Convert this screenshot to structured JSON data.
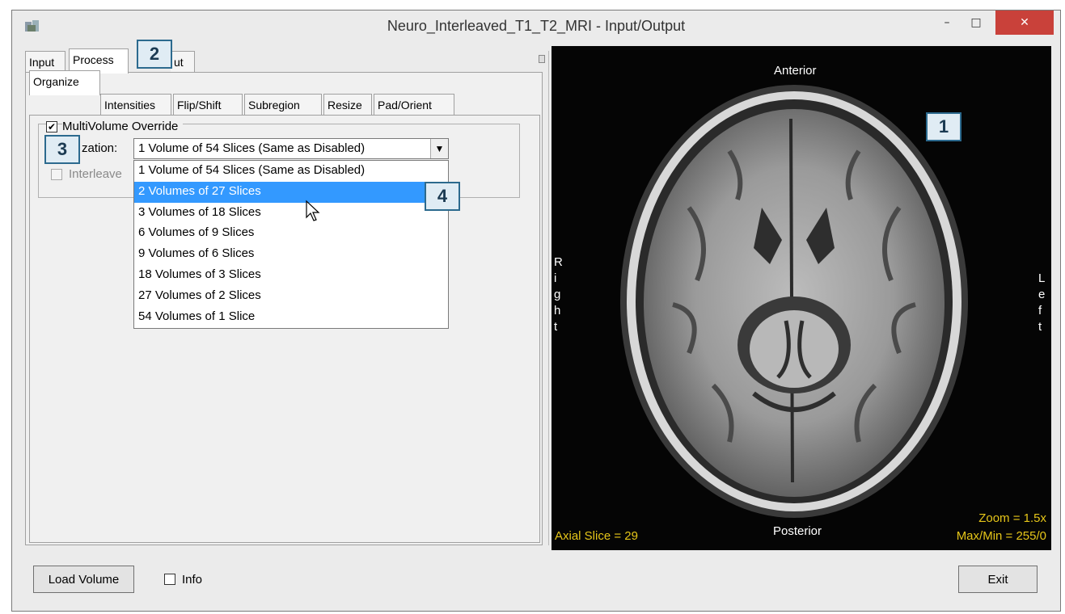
{
  "window": {
    "title": "Neuro_Interleaved_T1_T2_MRI - Input/Output",
    "minimize_glyph": "–",
    "maximize_glyph": "□",
    "close_glyph": "✕"
  },
  "main_tabs": [
    {
      "label": "Input"
    },
    {
      "label": "Process"
    },
    {
      "label": "ut"
    }
  ],
  "sub_tabs": [
    {
      "label": "Organize"
    },
    {
      "label": "Intensities"
    },
    {
      "label": "Flip/Shift"
    },
    {
      "label": "Subregion"
    },
    {
      "label": "Resize"
    },
    {
      "label": "Pad/Orient"
    }
  ],
  "organize": {
    "multivolume_label": "MultiVolume Override",
    "multivolume_checked": true,
    "organization_label_visible": "zation:",
    "select_value": "1 Volume of 54 Slices (Same as Disabled)",
    "interleave_label_visible": "Interleave",
    "dropdown_options": [
      "1 Volume of 54 Slices (Same as Disabled)",
      "2 Volumes of 27 Slices",
      "3 Volumes of 18 Slices",
      "6 Volumes of 9 Slices",
      "9 Volumes of 6 Slices",
      "18 Volumes of 3 Slices",
      "27 Volumes of 2 Slices",
      "54 Volumes of 1 Slice"
    ],
    "highlighted_option": "2 Volumes of 27 Slices"
  },
  "callouts": [
    "1",
    "2",
    "3",
    "4"
  ],
  "viewer": {
    "anterior": "Anterior",
    "posterior": "Posterior",
    "right": "R i g h t",
    "left": "L e f t",
    "slice_text": "Axial Slice = 29",
    "zoom_text": "Zoom = 1.5x",
    "maxmin_text": "Max/Min = 255/0"
  },
  "bottom": {
    "load_label": "Load Volume",
    "info_label": "Info",
    "exit_label": "Exit"
  },
  "colors": {
    "accent": "#3399ff",
    "callout_border": "#2c6a8e",
    "overlay_yellow": "#e6c619",
    "close_red": "#c9413a"
  }
}
